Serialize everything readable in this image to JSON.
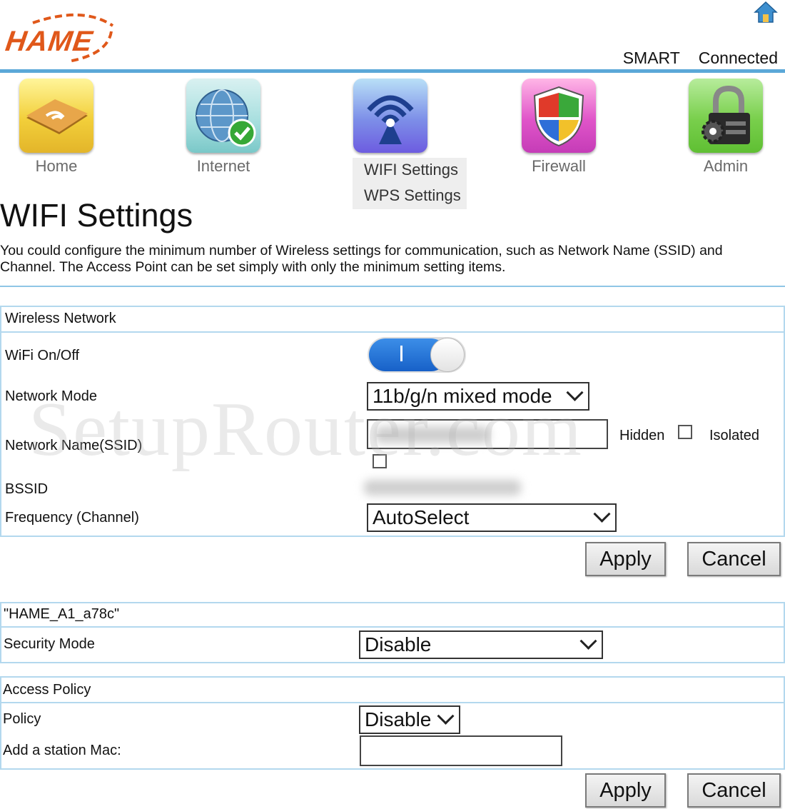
{
  "header": {
    "brand": "HAME",
    "operator": "SMART",
    "connection_status": "Connected"
  },
  "nav": {
    "items": [
      {
        "label": "Home",
        "icon": "home-arrow-icon"
      },
      {
        "label": "Internet",
        "icon": "globe-check-icon"
      },
      {
        "label": "WIFI Settings",
        "icon": "wifi-antenna-icon"
      },
      {
        "label": "Firewall",
        "icon": "shield-icon"
      },
      {
        "label": "Admin",
        "icon": "gear-lock-icon"
      }
    ],
    "submenu": [
      "WIFI Settings",
      "WPS Settings"
    ]
  },
  "page": {
    "title": "WIFI Settings",
    "description": "You could configure the minimum number of Wireless settings for communication, such as Network Name (SSID) and Channel. The Access Point can be set simply with only the minimum setting items."
  },
  "watermark": "SetupRouter.com",
  "wireless": {
    "header": "Wireless Network",
    "wifi_label": "WiFi On/Off",
    "wifi_enabled": true,
    "mode_label": "Network Mode",
    "mode_value": "11b/g/n mixed mode",
    "ssid_label": "Network Name(SSID)",
    "ssid_value": "",
    "hidden_label": "Hidden",
    "isolated_label": "Isolated",
    "bssid_label": "BSSID",
    "freq_label": "Frequency (Channel)",
    "freq_value": "AutoSelect",
    "apply_label": "Apply",
    "cancel_label": "Cancel"
  },
  "security": {
    "header": "\"HAME_A1_a78c\"",
    "mode_label": "Security Mode",
    "mode_value": "Disable"
  },
  "access": {
    "header": "Access Policy",
    "policy_label": "Policy",
    "policy_value": "Disable",
    "mac_label": "Add a station Mac:",
    "mac_value": "",
    "apply_label": "Apply",
    "cancel_label": "Cancel"
  },
  "colors": {
    "accent": "#5ba8d8",
    "brand": "#e0581a",
    "toggle_on": "#1f6fd6"
  }
}
